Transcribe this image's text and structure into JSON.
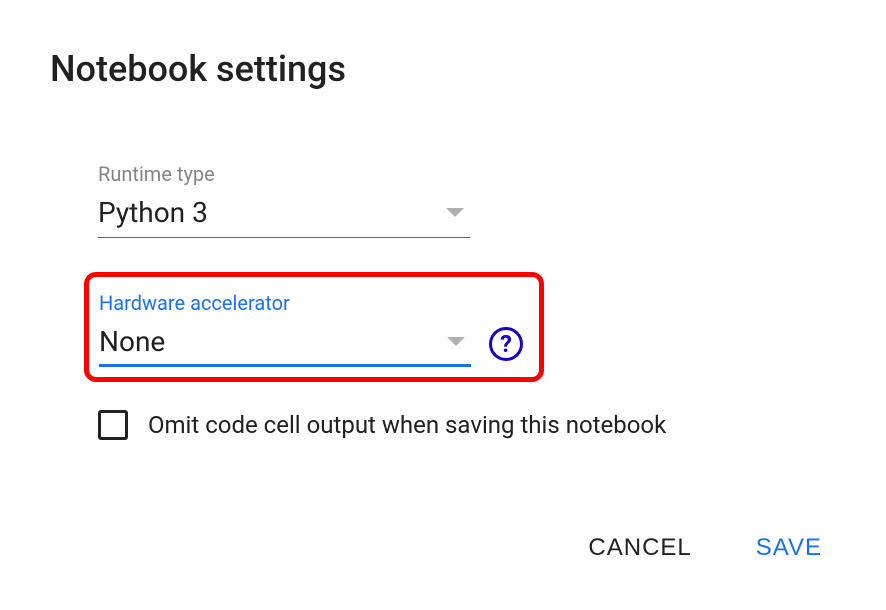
{
  "dialog": {
    "title": "Notebook settings"
  },
  "runtime": {
    "label": "Runtime type",
    "value": "Python 3"
  },
  "accelerator": {
    "label": "Hardware accelerator",
    "value": "None",
    "help_symbol": "?"
  },
  "omit": {
    "label": "Omit code cell output when saving this notebook",
    "checked": false
  },
  "footer": {
    "cancel": "CANCEL",
    "save": "SAVE"
  }
}
